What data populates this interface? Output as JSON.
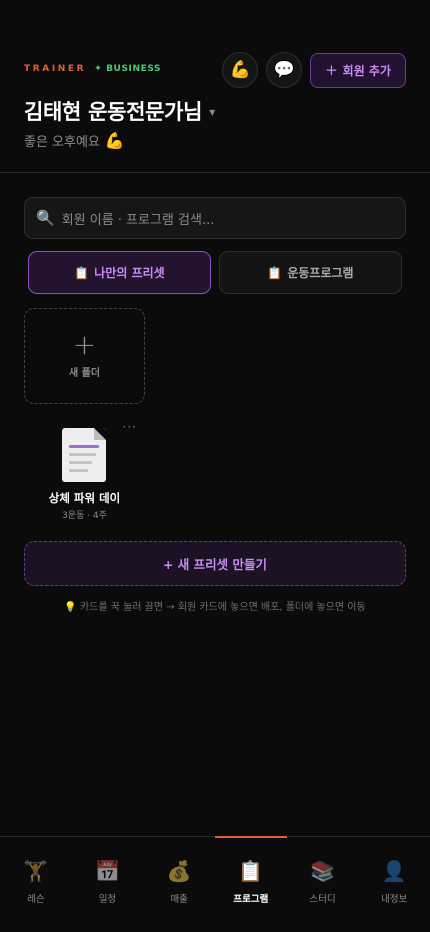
{
  "brand": {
    "trainer": "TRAINER",
    "business_mark": "✦",
    "business": "BUSINESS"
  },
  "header": {
    "muscle_icon": "💪",
    "chat_icon": "💬",
    "add_member_plus": "+",
    "add_member_label": "회원 추가",
    "title": "김태현 운동전문가님",
    "title_caret": "▾",
    "greeting": "좋은 오후예요",
    "greeting_emoji": "💪"
  },
  "search": {
    "icon": "🔍",
    "placeholder": "회원 이름 · 프로그램 검색..."
  },
  "tabs": [
    {
      "icon": "📋",
      "label": "나만의 프리셋",
      "active": true
    },
    {
      "icon": "📋",
      "label": "운동프로그램",
      "active": false
    }
  ],
  "new_folder": {
    "icon": "+",
    "label": "새 폴더"
  },
  "presets": [
    {
      "more": "···",
      "name": "상체 파워 데이",
      "meta": "3운동 · 4주"
    }
  ],
  "new_preset_button": "+ 새 프리셋 만들기",
  "hint": "💡 카드를 꾹 눌러 끌면 → 회원 카드에 놓으면 배포, 폴더에 놓으면 이동",
  "bottom_nav": [
    {
      "icon": "🏋️",
      "label": "레슨",
      "active": false
    },
    {
      "icon": "📅",
      "label": "일정",
      "active": false
    },
    {
      "icon": "💰",
      "label": "매출",
      "active": false
    },
    {
      "icon": "📋",
      "label": "프로그램",
      "active": true
    },
    {
      "icon": "📚",
      "label": "스터디",
      "active": false
    },
    {
      "icon": "👤",
      "label": "내정보",
      "active": false
    }
  ],
  "colors": {
    "accent": "#c88cf2",
    "brand_orange": "#e0603a",
    "brand_green": "#4ec776"
  }
}
